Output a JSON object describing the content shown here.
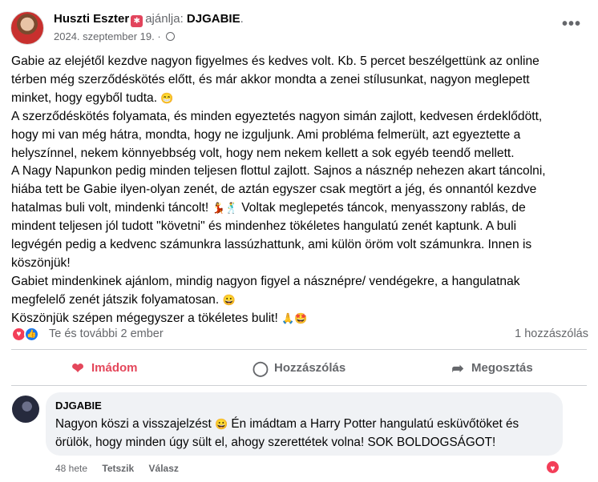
{
  "post": {
    "author": "Huszti Eszter",
    "recommends_word": "ajánlja:",
    "recommends_target": "DJGABIE",
    "date": "2024. szeptember 19.",
    "separator": "·",
    "more": "•••",
    "body_lines": [
      "Gabie az elejétől kezdve nagyon figyelmes és kedves volt. Kb. 5 percet beszélgettünk az online",
      "térben még szerződéskötés előtt, és már akkor mondta a zenei stílusunkat, nagyon meglepett",
      "minket, hogy egyből tudta.",
      "A szerződéskötés folyamata, és minden egyeztetés nagyon simán zajlott, kedvesen érdeklődött,",
      "hogy mi van még hátra, mondta, hogy ne izguljunk. Ami probléma felmerült, azt egyeztette a",
      "helyszínnel, nekem könnyebbség volt, hogy nem nekem kellett a sok egyéb teendő mellett.",
      "A Nagy Napunkon pedig minden teljesen flottul zajlott. Sajnos a násznép nehezen akart táncolni,",
      "hiába tett be Gabie ilyen-olyan zenét, de aztán egyszer csak megtört a jég, és onnantól kezdve",
      "hatalmas buli volt, mindenki táncolt!",
      "Voltak meglepetés táncok, menyasszony rablás, de",
      "mindent teljesen jól tudott \"követni\" és mindenhez tökéletes hangulatú zenét kaptunk. A buli",
      "legvégén pedig a kedvenc számunkra lassúzhattunk, ami külön öröm volt számunkra. Innen is",
      "köszönjük!",
      "Gabiet mindenkinek ajánlom, mindig nagyon figyel a násznépre/ vendégekre, a hangulatnak",
      "megfelelő zenét játszik folyamatosan.",
      "Köszönjük szépen mégegyszer a tökéletes bulit!"
    ],
    "emojis": {
      "grin": "😁",
      "dancer": "💃",
      "man_dancing": "🕺",
      "smile": "😀",
      "pray": "🙏",
      "star_struck": "🤩"
    },
    "reactions_text": "Te és további 2 ember",
    "comment_count": "1 hozzászólás"
  },
  "actions": {
    "love": "Imádom",
    "comment": "Hozzászólás",
    "share": "Megosztás"
  },
  "comment": {
    "author": "DJGABIE",
    "line1": "Nagyon köszi a visszajelzést",
    "line1b": "Én imádtam a Harry Potter hangulatú esküvőtöket és",
    "line2": "örülök, hogy minden úgy sült el, ahogy szerettétek volna! SOK BOLDOGSÁGOT!",
    "emoji": "😀",
    "age": "48 hete",
    "like": "Tetszik",
    "reply": "Válasz"
  },
  "colors": {
    "accent_love": "#e4475b",
    "like_blue": "#1877f2",
    "meta_gray": "#65676b",
    "bubble_bg": "#f0f2f5"
  },
  "icons": [
    "globe-icon",
    "more-icon",
    "love-reaction-icon",
    "like-reaction-icon",
    "heart-icon",
    "comment-icon",
    "share-icon"
  ]
}
